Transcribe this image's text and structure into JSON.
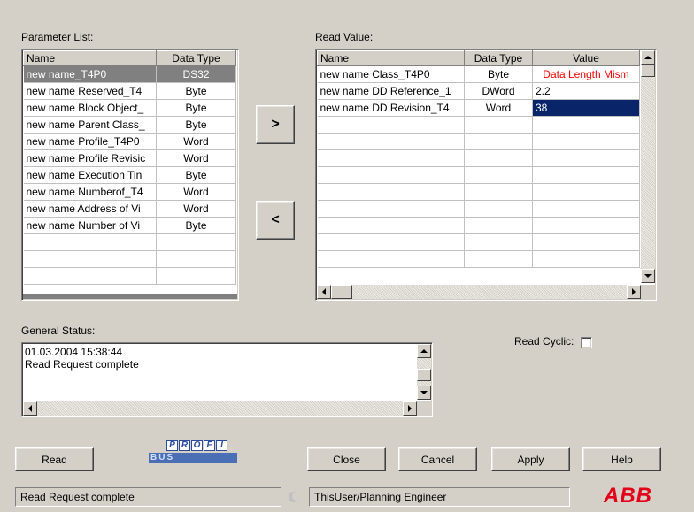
{
  "parameter_list": {
    "label": "Parameter List:",
    "columns": [
      "Name",
      "Data Type"
    ],
    "rows": [
      {
        "name": "new name_T4P0",
        "type": "DS32"
      },
      {
        "name": "new name Reserved_T4",
        "type": "Byte"
      },
      {
        "name": "new name Block Object_",
        "type": "Byte"
      },
      {
        "name": "new name Parent Class_",
        "type": "Byte"
      },
      {
        "name": "new name Profile_T4P0",
        "type": "Word"
      },
      {
        "name": "new name Profile Revisic",
        "type": "Word"
      },
      {
        "name": "new name Execution Tin",
        "type": "Byte"
      },
      {
        "name": "new name Numberof_T4",
        "type": "Word"
      },
      {
        "name": "new name Address of Vi",
        "type": "Word"
      },
      {
        "name": "new name Number of Vi",
        "type": "Byte"
      }
    ]
  },
  "read_value": {
    "label": "Read Value:",
    "columns": [
      "Name",
      "Data Type",
      "Value"
    ],
    "rows": [
      {
        "name": "new name Class_T4P0",
        "type": "Byte",
        "value": "Data Length Mism"
      },
      {
        "name": "new name DD Reference_1",
        "type": "DWord",
        "value": "2.2"
      },
      {
        "name": "new name DD Revision_T4",
        "type": "Word",
        "value": "38"
      }
    ]
  },
  "move_buttons": {
    "add": ">",
    "remove": "<"
  },
  "general_status": {
    "label": "General Status:",
    "lines": [
      "01.03.2004 15:38:44",
      "Read Request complete"
    ]
  },
  "read_cyclic": {
    "label": "Read Cyclic:",
    "checked": false
  },
  "buttons": {
    "read": "Read",
    "close": "Close",
    "cancel": "Cancel",
    "apply": "Apply",
    "help": "Help"
  },
  "logo": {
    "profi_text": "PROFI",
    "sub_text": "BUS"
  },
  "status_bar": {
    "message": "Read Request complete",
    "user": "ThisUser/Planning Engineer"
  },
  "brand": {
    "text": "ABB",
    "color": "#e2001a"
  },
  "colors": {
    "error_text": "#ff0000",
    "selection_blue": "#0a246a",
    "selection_gray": "#808080"
  }
}
